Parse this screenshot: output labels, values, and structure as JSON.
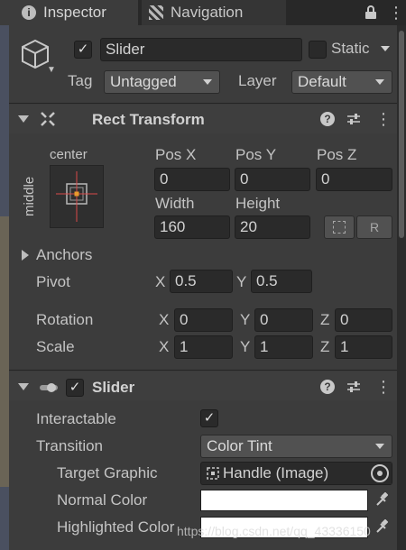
{
  "tabs": [
    {
      "label": "Inspector",
      "icon": "info-icon"
    },
    {
      "label": "Navigation",
      "icon": "navigation-icon"
    }
  ],
  "header": {
    "active": true,
    "name": "Slider",
    "static_label": "Static",
    "tag_label": "Tag",
    "tag_value": "Untagged",
    "layer_label": "Layer",
    "layer_value": "Default"
  },
  "rect_transform": {
    "title": "Rect Transform",
    "anchor_h": "center",
    "anchor_v": "middle",
    "pos_x_label": "Pos X",
    "pos_x": "0",
    "pos_y_label": "Pos Y",
    "pos_y": "0",
    "pos_z_label": "Pos Z",
    "pos_z": "0",
    "width_label": "Width",
    "width": "160",
    "height_label": "Height",
    "height": "20",
    "raw_button": "R",
    "anchors_label": "Anchors",
    "pivot_label": "Pivot",
    "pivot_x_label": "X",
    "pivot_x": "0.5",
    "pivot_y_label": "Y",
    "pivot_y": "0.5",
    "rotation_label": "Rotation",
    "rot_x_label": "X",
    "rot_x": "0",
    "rot_y_label": "Y",
    "rot_y": "0",
    "rot_z_label": "Z",
    "rot_z": "0",
    "scale_label": "Scale",
    "scale_x_label": "X",
    "scale_x": "1",
    "scale_y_label": "Y",
    "scale_y": "1",
    "scale_z_label": "Z",
    "scale_z": "1"
  },
  "slider": {
    "title": "Slider",
    "enabled": true,
    "interactable_label": "Interactable",
    "interactable": true,
    "transition_label": "Transition",
    "transition_value": "Color Tint",
    "target_graphic_label": "Target Graphic",
    "target_graphic_value": "Handle (Image)",
    "normal_color_label": "Normal Color",
    "normal_color": "#ffffff",
    "highlighted_color_label": "Highlighted Color",
    "highlighted_color": "#ffffff"
  },
  "watermark": "https://blog.csdn.net/qq_43336150"
}
